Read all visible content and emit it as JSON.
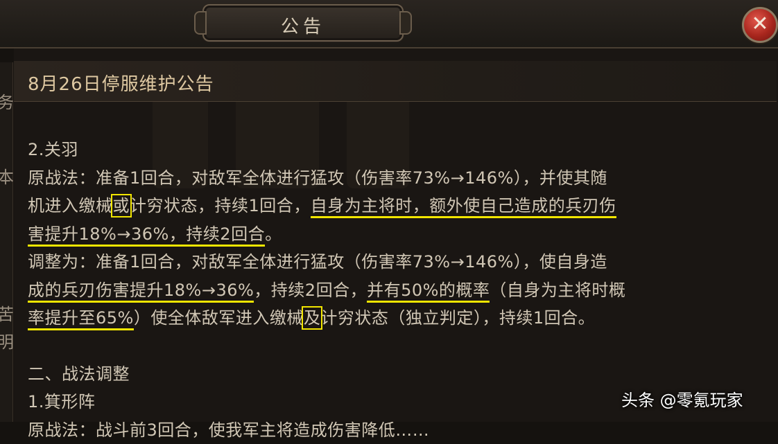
{
  "window": {
    "title": "公告",
    "close_label": "✕"
  },
  "sidebar": {
    "glyphs": [
      "务",
      "本",
      "苦",
      "明"
    ]
  },
  "notice": {
    "heading": "8月26日停服维护公告",
    "section_guanyu_title": "2.关羽",
    "orig": {
      "line1": "原战法：准备1回合，对敌军全体进行猛攻（伤害率73%→146%），并使其随",
      "line2_a": "机进入缴械",
      "line2_box": "或",
      "line2_b": "计穷状态，持续1回合，",
      "line2_hl": "自身为主将时，额外使自己造成的兵刃伤",
      "line3_hl": "害提升18%→36%，持续2回合",
      "line3_tail": "。"
    },
    "adjust": {
      "line1": "调整为：准备1回合，对敌军全体进行猛攻（伤害率73%→146%），使自身造",
      "line2_hl1": "成的兵刃伤害提升18%→36%",
      "line2_mid": "，持续2回合，",
      "line2_hl2": "并有50%的概率",
      "line2_tail": "（自身为主将时概",
      "line3_hl": "率提升至65%",
      "line3_a": "）使全体敌军进入缴械",
      "line3_box": "及",
      "line3_b": "计穷状态（独立判定），持续1回合。"
    },
    "section2_title": "二、战法调整",
    "section2_item1": "1.箕形阵",
    "cut_line": "原战法：战斗前3回合，使我军主将造成伤害降低……"
  },
  "attribution": "头条 @零氪玩家",
  "colors": {
    "highlight": "#f2e600",
    "text": "#d1c7b5",
    "heading": "#dfc9a2"
  }
}
